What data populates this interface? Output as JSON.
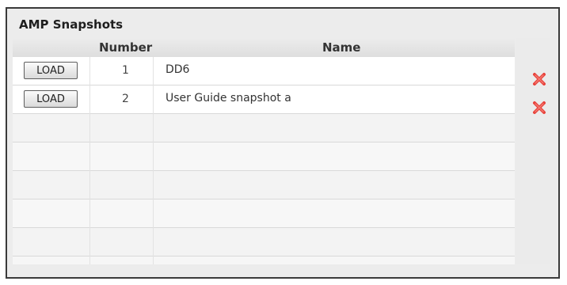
{
  "panel": {
    "title": "AMP Snapshots"
  },
  "table": {
    "columns": [
      "",
      "Number",
      "Name"
    ],
    "rows": [
      {
        "load_label": "LOAD",
        "number": "1",
        "name": "DD6",
        "delete_icon": "delete-x-icon"
      },
      {
        "load_label": "LOAD",
        "number": "2",
        "name": "User Guide snapshot a",
        "delete_icon": "delete-x-icon"
      }
    ],
    "empty_row_count": 5
  },
  "colors": {
    "delete_icon": "#e8423b",
    "panel_border": "#3a3a3a",
    "panel_background": "#ececec"
  }
}
